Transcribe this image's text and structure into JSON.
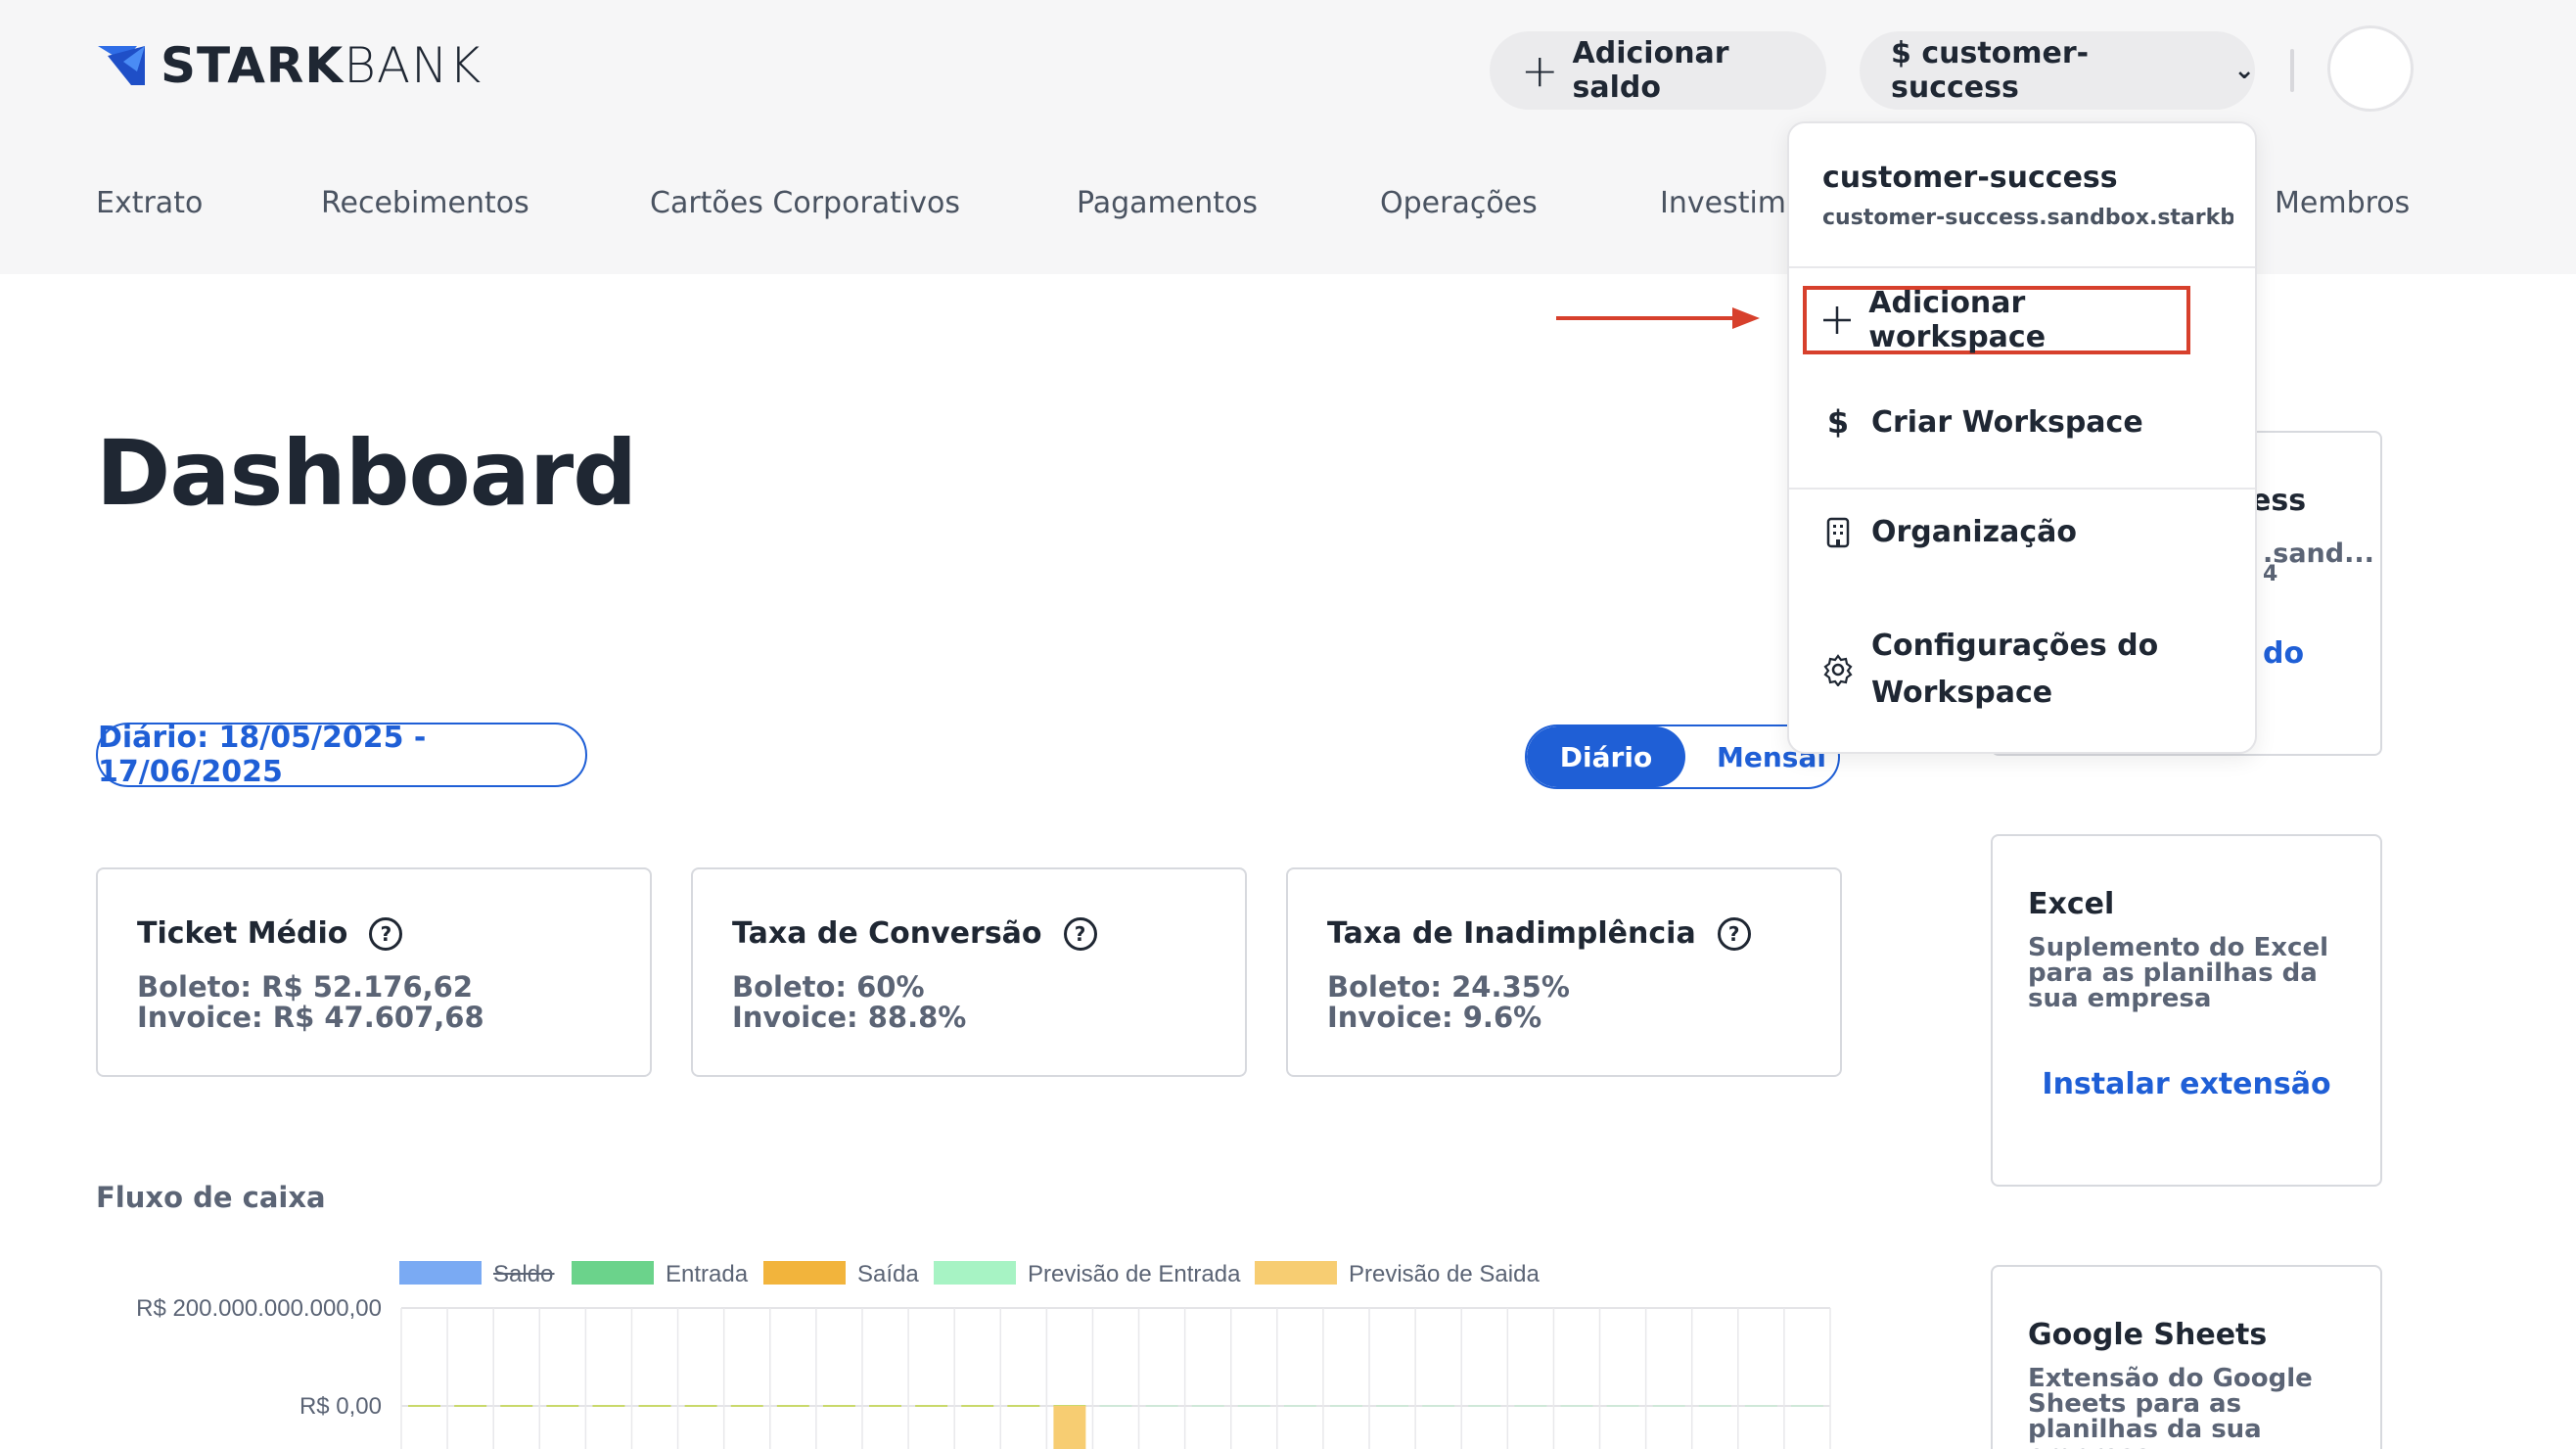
{
  "header": {
    "logo_bold": "STARK",
    "logo_light": "BANK",
    "add_balance": "Adicionar saldo",
    "workspace_selector": "$ customer-success"
  },
  "nav": {
    "items": [
      "Extrato",
      "Recebimentos",
      "Cartões Corporativos",
      "Pagamentos",
      "Operações",
      "Investime",
      "Membros"
    ]
  },
  "dashboard": {
    "title": "Dashboard",
    "date_range": "Diário: 18/05/2025 - 17/06/2025",
    "toggle": {
      "daily": "Diário",
      "monthly": "Mensal",
      "selected": "Diário"
    },
    "cards": [
      {
        "title": "Ticket Médio",
        "line1": "Boleto: R$ 52.176,62",
        "line2": "Invoice: R$ 47.607,68"
      },
      {
        "title": "Taxa de Conversão",
        "line1": "Boleto: 60%",
        "line2": "Invoice: 88.8%"
      },
      {
        "title": "Taxa de Inadimplência",
        "line1": "Boleto: 24.35%",
        "line2": "Invoice: 9.6%"
      }
    ],
    "cashflow_title": "Fluxo de caixa"
  },
  "chart_data": {
    "type": "bar",
    "title": "",
    "legend": [
      {
        "name": "Saldo",
        "color": "#7aaaf3",
        "hidden": true
      },
      {
        "name": "Entrada",
        "color": "#6bd38b"
      },
      {
        "name": "Saída",
        "color": "#f2b43c"
      },
      {
        "name": "Previsão de Entrada",
        "color": "#a7f3c4"
      },
      {
        "name": "Previsão de Saida",
        "color": "#f7cd72"
      }
    ],
    "yticks": [
      "R$  200.000.000.000,00",
      "R$  0,00"
    ],
    "ylim": [
      0,
      200000000000
    ],
    "columns": 31,
    "series": [
      {
        "name": "Saída",
        "values": [
          0,
          0,
          0,
          0,
          0,
          0,
          0,
          0,
          0,
          0,
          0,
          0,
          0,
          0,
          -5000000000,
          0,
          0,
          0,
          0,
          0,
          0,
          0,
          0,
          0,
          0,
          0,
          0,
          0,
          0,
          0,
          0
        ]
      }
    ]
  },
  "sidebar": {
    "top_card_peek": {
      "title_tail": "ess",
      "line1_tail": ".sand...",
      "line2_tail": "4",
      "link_tail": "do"
    },
    "excel": {
      "title": "Excel",
      "desc": "Suplemento do Excel para as planilhas da sua empresa",
      "link": "Instalar extensão"
    },
    "gsheets": {
      "title": "Google Sheets",
      "desc": "Extensão do Google Sheets para as planilhas da sua empresa"
    }
  },
  "dropdown": {
    "workspace_name": "customer-success",
    "workspace_domain": "customer-success.sandbox.starkba...",
    "items": [
      {
        "label": "Adicionar workspace",
        "icon": "plus-icon",
        "highlighted": true
      },
      {
        "label": "Criar Workspace",
        "icon": "dollar-icon"
      },
      {
        "label": "Organização",
        "icon": "building-icon"
      },
      {
        "label": "Configurações do Workspace",
        "icon": "gear-icon"
      }
    ]
  },
  "annotation": {
    "arrow_color": "#d7402c",
    "highlight_color": "#d7402c"
  }
}
